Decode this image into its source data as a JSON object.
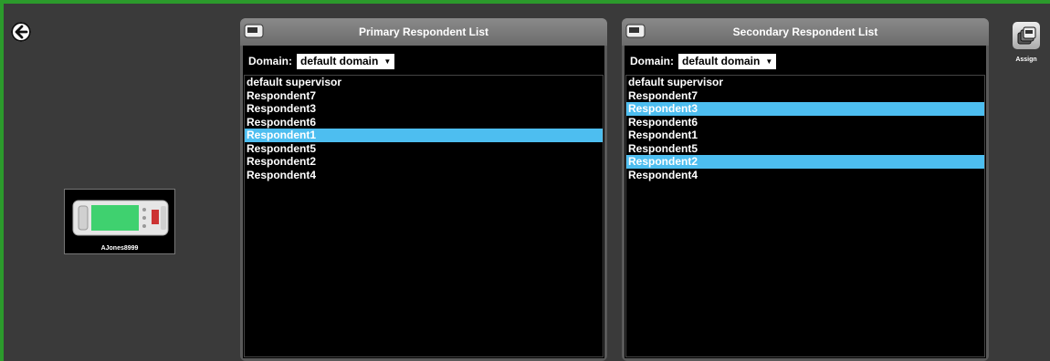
{
  "back_icon": "arrow-left-circle-icon",
  "device": {
    "name": "AJones8999",
    "icon": "pager-device-icon",
    "screen_color": "#3fd16f"
  },
  "primary": {
    "title": "Primary Respondent List",
    "domain_label": "Domain:",
    "domain_value": "default domain",
    "items": [
      {
        "label": "default supervisor",
        "selected": false
      },
      {
        "label": "Respondent7",
        "selected": false
      },
      {
        "label": "Respondent3",
        "selected": false
      },
      {
        "label": "Respondent6",
        "selected": false
      },
      {
        "label": "Respondent1",
        "selected": true
      },
      {
        "label": "Respondent5",
        "selected": false
      },
      {
        "label": "Respondent2",
        "selected": false
      },
      {
        "label": "Respondent4",
        "selected": false
      }
    ]
  },
  "secondary": {
    "title": "Secondary Respondent List",
    "domain_label": "Domain:",
    "domain_value": "default domain",
    "items": [
      {
        "label": "default supervisor",
        "selected": false
      },
      {
        "label": "Respondent7",
        "selected": false
      },
      {
        "label": "Respondent3",
        "selected": true
      },
      {
        "label": "Respondent6",
        "selected": false
      },
      {
        "label": "Respondent1",
        "selected": false
      },
      {
        "label": "Respondent5",
        "selected": false
      },
      {
        "label": "Respondent2",
        "selected": true
      },
      {
        "label": "Respondent4",
        "selected": false
      }
    ]
  },
  "assign": {
    "label": "Assign",
    "icon": "assign-stack-icon"
  },
  "colors": {
    "frame": "#2c9a2c",
    "selection": "#4dbef0",
    "background": "#3a3a3a"
  }
}
